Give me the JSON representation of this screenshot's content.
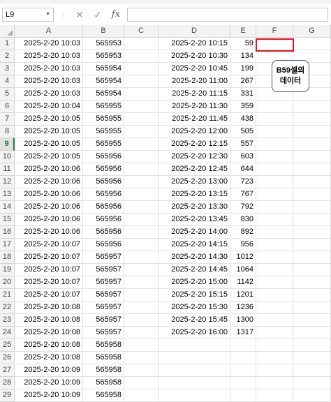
{
  "formula_bar": {
    "name_box": "L9",
    "cancel_icon": "x-icon",
    "enter_icon": "check-icon",
    "function_icon": "fx",
    "formula_value": ""
  },
  "columns": [
    "A",
    "B",
    "C",
    "D",
    "E",
    "F",
    "G"
  ],
  "selected_row": "9",
  "rows": [
    {
      "n": "1",
      "a": "2025-2-20 10:03",
      "b": "565953",
      "d": "2025-2-20 10:15",
      "e": "59"
    },
    {
      "n": "2",
      "a": "2025-2-20 10:03",
      "b": "565953",
      "d": "2025-2-20 10:30",
      "e": "134"
    },
    {
      "n": "3",
      "a": "2025-2-20 10:03",
      "b": "565954",
      "d": "2025-2-20 10:45",
      "e": "199"
    },
    {
      "n": "4",
      "a": "2025-2-20 10:03",
      "b": "565954",
      "d": "2025-2-20 11:00",
      "e": "267"
    },
    {
      "n": "5",
      "a": "2025-2-20 10:03",
      "b": "565954",
      "d": "2025-2-20 11:15",
      "e": "331"
    },
    {
      "n": "6",
      "a": "2025-2-20 10:04",
      "b": "565955",
      "d": "2025-2-20 11:30",
      "e": "359"
    },
    {
      "n": "7",
      "a": "2025-2-20 10:05",
      "b": "565955",
      "d": "2025-2-20 11:45",
      "e": "438"
    },
    {
      "n": "8",
      "a": "2025-2-20 10:05",
      "b": "565955",
      "d": "2025-2-20 12:00",
      "e": "505"
    },
    {
      "n": "9",
      "a": "2025-2-20 10:05",
      "b": "565955",
      "d": "2025-2-20 12:15",
      "e": "557"
    },
    {
      "n": "10",
      "a": "2025-2-20 10:05",
      "b": "565956",
      "d": "2025-2-20 12:30",
      "e": "603"
    },
    {
      "n": "11",
      "a": "2025-2-20 10:06",
      "b": "565956",
      "d": "2025-2-20 12:45",
      "e": "644"
    },
    {
      "n": "12",
      "a": "2025-2-20 10:06",
      "b": "565956",
      "d": "2025-2-20 13:00",
      "e": "723"
    },
    {
      "n": "13",
      "a": "2025-2-20 10:06",
      "b": "565956",
      "d": "2025-2-20 13:15",
      "e": "767"
    },
    {
      "n": "14",
      "a": "2025-2-20 10:06",
      "b": "565956",
      "d": "2025-2-20 13:30",
      "e": "792"
    },
    {
      "n": "15",
      "a": "2025-2-20 10:06",
      "b": "565956",
      "d": "2025-2-20 13:45",
      "e": "830"
    },
    {
      "n": "16",
      "a": "2025-2-20 10:06",
      "b": "565956",
      "d": "2025-2-20 14:00",
      "e": "892"
    },
    {
      "n": "17",
      "a": "2025-2-20 10:07",
      "b": "565956",
      "d": "2025-2-20 14:15",
      "e": "956"
    },
    {
      "n": "18",
      "a": "2025-2-20 10:07",
      "b": "565957",
      "d": "2025-2-20 14:30",
      "e": "1012"
    },
    {
      "n": "19",
      "a": "2025-2-20 10:07",
      "b": "565957",
      "d": "2025-2-20 14:45",
      "e": "1064"
    },
    {
      "n": "20",
      "a": "2025-2-20 10:07",
      "b": "565957",
      "d": "2025-2-20 15:00",
      "e": "1142"
    },
    {
      "n": "21",
      "a": "2025-2-20 10:07",
      "b": "565957",
      "d": "2025-2-20 15:15",
      "e": "1201"
    },
    {
      "n": "22",
      "a": "2025-2-20 10:08",
      "b": "565957",
      "d": "2025-2-20 15:30",
      "e": "1236"
    },
    {
      "n": "23",
      "a": "2025-2-20 10:08",
      "b": "565957",
      "d": "2025-2-20 15:45",
      "e": "1300"
    },
    {
      "n": "24",
      "a": "2025-2-20 10:08",
      "b": "565957",
      "d": "2025-2-20 16:00",
      "e": "1317"
    },
    {
      "n": "25",
      "a": "2025-2-20 10:08",
      "b": "565958",
      "d": "",
      "e": ""
    },
    {
      "n": "26",
      "a": "2025-2-20 10:08",
      "b": "565958",
      "d": "",
      "e": ""
    },
    {
      "n": "27",
      "a": "2025-2-20 10:09",
      "b": "565958",
      "d": "",
      "e": ""
    },
    {
      "n": "28",
      "a": "2025-2-20 10:09",
      "b": "565958",
      "d": "",
      "e": ""
    },
    {
      "n": "29",
      "a": "2025-2-20 10:09",
      "b": "565958",
      "d": "",
      "e": ""
    }
  ],
  "callout": {
    "line1": "B59셀의",
    "line2": "데이터",
    "border_color": "#e81123"
  },
  "colors": {
    "accent": "#217346",
    "highlight_border": "#e81123",
    "gridline": "#e1e1e1",
    "header_bg": "#f3f3f3"
  }
}
